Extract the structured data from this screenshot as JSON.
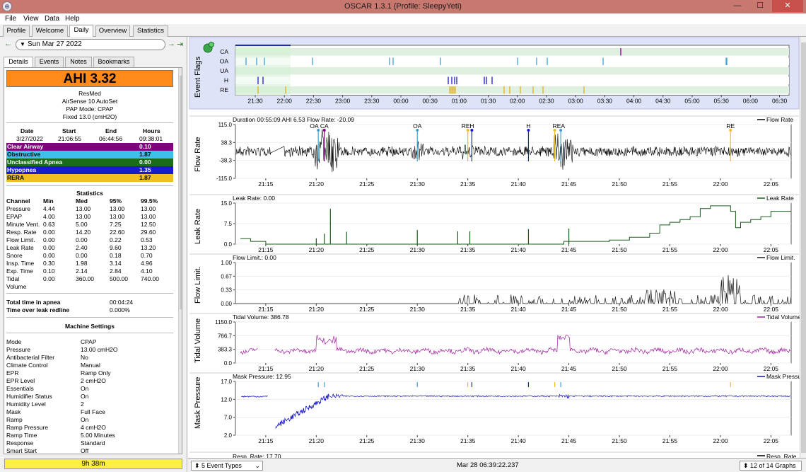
{
  "window": {
    "title": "OSCAR 1.3.1 (Profile: SleepyYeti)",
    "minimize": "—",
    "maximize": "☐",
    "close": "✕"
  },
  "menu": [
    "File",
    "View",
    "Data",
    "Help"
  ],
  "tabs": [
    "Profile",
    "Welcome",
    "Daily",
    "Overview",
    "Statistics"
  ],
  "nav": {
    "prev": "←",
    "date": "Sun Mar 27 2022",
    "dropdown": "▼",
    "next": "→",
    "last": "⇥"
  },
  "subtabs": [
    "Details",
    "Events",
    "Notes",
    "Bookmarks"
  ],
  "details": {
    "ahi": "AHI 3.32",
    "machine": [
      "ResMed",
      "AirSense 10 AutoSet",
      "PAP Mode: CPAP",
      "Fixed 13.0 (cmH2O)"
    ],
    "session_headers": [
      "Date",
      "Start",
      "End",
      "Hours"
    ],
    "session_values": [
      "3/27/2022",
      "21:06:55",
      "06:44:56",
      "09:38:01"
    ],
    "events": [
      {
        "name": "Clear Airway",
        "value": "0.10",
        "color": "#800080",
        "text": "#ffffff"
      },
      {
        "name": "Obstructive",
        "value": "1.87",
        "color": "#40c0e8",
        "text": "#000000"
      },
      {
        "name": "Unclassified Apnea",
        "value": "0.00",
        "color": "#1a6b1a",
        "text": "#ffffff"
      },
      {
        "name": "Hypopnea",
        "value": "1.35",
        "color": "#1a1ad0",
        "text": "#ffffff"
      },
      {
        "name": "RERA",
        "value": "1.87",
        "color": "#f0c020",
        "text": "#000000"
      }
    ],
    "statistics_title": "Statistics",
    "stat_headers": [
      "Channel",
      "Min",
      "Med",
      "95%",
      "99.5%"
    ],
    "stats": [
      [
        "Pressure",
        "4.44",
        "13.00",
        "13.00",
        "13.00"
      ],
      [
        "EPAP",
        "4.00",
        "13.00",
        "13.00",
        "13.00"
      ],
      [
        "Minute Vent.",
        "0.63",
        "5.00",
        "7.25",
        "12.50"
      ],
      [
        "Resp. Rate",
        "0.00",
        "14.20",
        "22.60",
        "29.60"
      ],
      [
        "Flow Limit.",
        "0.00",
        "0.00",
        "0.22",
        "0.53"
      ],
      [
        "Leak Rate",
        "0.00",
        "2.40",
        "9.60",
        "13.20"
      ],
      [
        "Snore",
        "0.00",
        "0.00",
        "0.18",
        "0.70"
      ],
      [
        "Insp. Time",
        "0.30",
        "1.98",
        "3.14",
        "4.96"
      ],
      [
        "Exp. Time",
        "0.10",
        "2.14",
        "2.84",
        "4.10"
      ],
      [
        "Tidal",
        "0.00",
        "360.00",
        "500.00",
        "740.00"
      ]
    ],
    "tidal_cont": "Volume",
    "apnea_label": "Total time in apnea",
    "apnea_value": "00:04:24",
    "leak_label": "Time over leak redline",
    "leak_value": "0.000%",
    "machine_settings_title": "Machine Settings",
    "settings": [
      [
        "Mode",
        "CPAP"
      ],
      [
        "Pressure",
        "13.00 cmH2O"
      ],
      [
        "Antibacterial Filter",
        "No"
      ],
      [
        "Climate Control",
        "Manual"
      ],
      [
        "EPR",
        "Ramp Only"
      ],
      [
        "EPR Level",
        "2 cmH2O"
      ],
      [
        "Essentials",
        "On"
      ],
      [
        "Humidifier Status",
        "On"
      ],
      [
        "Humidity Level",
        "2"
      ],
      [
        "Mask",
        "Full Face"
      ],
      [
        "Ramp",
        "On"
      ],
      [
        "Ramp Pressure",
        "4 cmH2O"
      ],
      [
        "Ramp Time",
        "5.00 Minutes"
      ],
      [
        "Response",
        "Standard"
      ],
      [
        "Smart Start",
        "Off"
      ]
    ],
    "total_time": "9h 38m"
  },
  "graphs": {
    "event_flags": {
      "title": "Event Flags",
      "rows": [
        "CA",
        "OA",
        "UA",
        "H",
        "RE"
      ],
      "ticks": [
        "21:30",
        "22:00",
        "22:30",
        "23:00",
        "23:30",
        "00:00",
        "00:30",
        "01:00",
        "01:30",
        "02:00",
        "02:30",
        "03:00",
        "03:30",
        "04:00",
        "04:30",
        "05:00",
        "05:30",
        "06:00",
        "06:30"
      ]
    },
    "time_ticks": [
      "21:15",
      "21:20",
      "21:25",
      "21:30",
      "21:35",
      "21:40",
      "21:45",
      "21:50",
      "21:55",
      "22:00",
      "22:05"
    ],
    "flow_rate": {
      "title": "Flow Rate",
      "info": "Duration 00:55:09 AHI 6.53 Flow Rate: -20.09",
      "legend": "Flow Rate",
      "yticks": [
        "115.0",
        "38.3",
        "-38.3",
        "-115.0"
      ],
      "events": [
        {
          "label": "OA",
          "t": "21:20"
        },
        {
          "label": "CA",
          "t": "21:20"
        },
        {
          "label": "OA",
          "t": "21:30"
        },
        {
          "label": "REH",
          "t": "21:35"
        },
        {
          "label": "H",
          "t": "21:41"
        },
        {
          "label": "REA",
          "t": "21:44"
        },
        {
          "label": "RE",
          "t": "22:01"
        }
      ]
    },
    "leak_rate": {
      "title": "Leak Rate",
      "info": "Leak Rate: 0.00",
      "legend": "Leak Rate",
      "yticks": [
        "15.0",
        "7.5",
        "0.0"
      ]
    },
    "flow_limit": {
      "title": "Flow Limit.",
      "info": "Flow Limit.: 0.00",
      "legend": "Flow Limit.",
      "yticks": [
        "1.00",
        "0.67",
        "0.33",
        "0.00"
      ]
    },
    "tidal_volume": {
      "title": "Tidal Volume",
      "info": "Tidal Volume: 386.78",
      "legend": "Tidal Volume",
      "yticks": [
        "1150.0",
        "766.7",
        "383.3",
        "0.0"
      ]
    },
    "mask_pressure": {
      "title": "Mask Pressure",
      "info": "Mask Pressure: 12.95",
      "legend": "Mask Pressure",
      "yticks": [
        "17.0",
        "12.0",
        "7.0",
        "2.0"
      ]
    },
    "resp_rate_partial": {
      "info": "Resp. Rate: 17.70",
      "legend": "Resp. Rate"
    }
  },
  "status": {
    "event_types": "5 Event Types",
    "timestamp": "Mar 28 06:39:22.237",
    "graph_count": "12 of 14 Graphs"
  },
  "colors": {
    "flow": "#000000",
    "leak": "#1a5c1a",
    "flowlimit": "#1a1a1a",
    "tidal": "#a020a0",
    "mask": "#1010c0",
    "ahi": "#ff8a1a",
    "timebar": "#ffee44"
  }
}
